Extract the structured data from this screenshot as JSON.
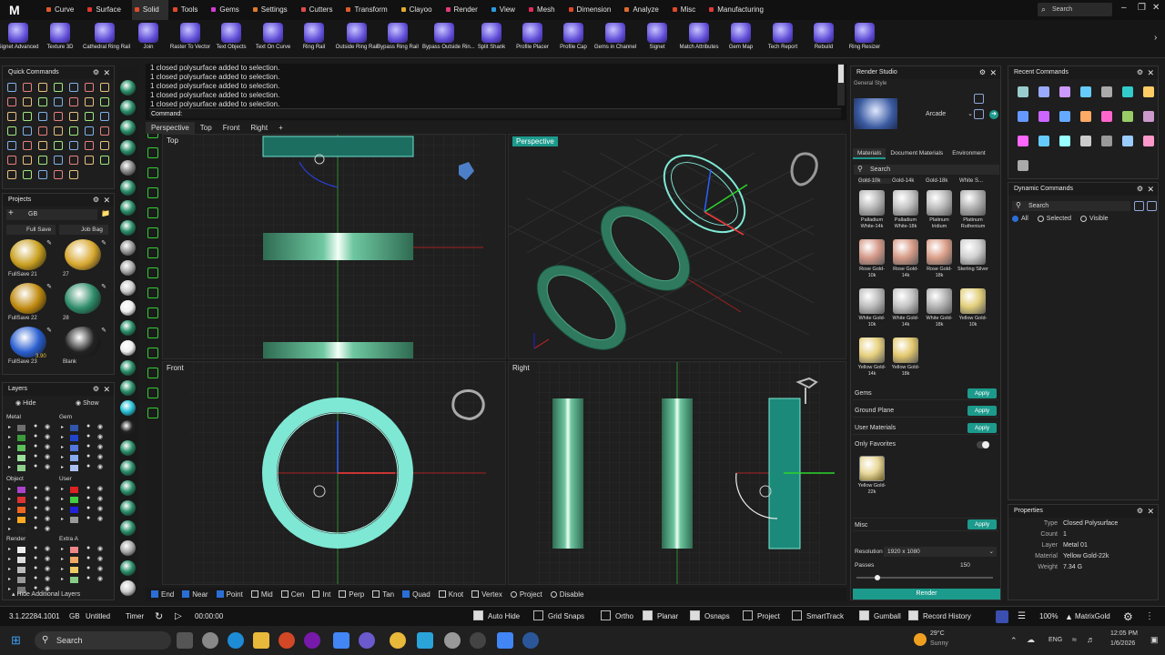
{
  "menubar": {
    "logo": "M",
    "search_placeholder": "Search",
    "items": [
      {
        "label": "Curve",
        "color": "#e05a2b"
      },
      {
        "label": "Surface",
        "color": "#e0362b"
      },
      {
        "label": "Solid",
        "color": "#e04b2b",
        "active": true
      },
      {
        "label": "Tools",
        "color": "#e0482b"
      },
      {
        "label": "Gems",
        "color": "#d43bd4"
      },
      {
        "label": "Settings",
        "color": "#e07a2b"
      },
      {
        "label": "Cutters",
        "color": "#e04b4b"
      },
      {
        "label": "Transform",
        "color": "#e05a2b"
      },
      {
        "label": "Clayoo",
        "color": "#e0aa2b"
      },
      {
        "label": "Render",
        "color": "#e03b7a"
      },
      {
        "label": "View",
        "color": "#2b9ae0"
      },
      {
        "label": "Mesh",
        "color": "#e02b5a"
      },
      {
        "label": "Dimension",
        "color": "#e0482b"
      },
      {
        "label": "Analyze",
        "color": "#e06a2b"
      },
      {
        "label": "Misc",
        "color": "#e0482b"
      },
      {
        "label": "Manufacturing",
        "color": "#e03b3b"
      }
    ]
  },
  "toolbar": {
    "tools": [
      "Signet Advanced",
      "Texture 3D",
      "Cathedral Ring Rail",
      "Join",
      "Raster To Vector",
      "Text Objects",
      "Text On Curve",
      "Ring Rail",
      "Outside Ring Rail",
      "Bypass Ring Rail",
      "Bypass Outside Rin...",
      "Split Shank",
      "Profile Placer",
      "Profile Cap",
      "Gems in Channel",
      "Signet",
      "Match Attributes",
      "Gem Map",
      "Tech Report",
      "Rebuild",
      "Ring Resizer"
    ]
  },
  "quick_commands": {
    "title": "Quick Commands"
  },
  "projects": {
    "title": "Projects",
    "folder": "GB",
    "full_save": "Full Save",
    "job_bag": "Job Bag",
    "items": [
      {
        "label": "FullSave 21",
        "color": "#c9a020"
      },
      {
        "label": "27",
        "color": "#d8a830"
      },
      {
        "label": "FullSave 22",
        "color": "#c08a10"
      },
      {
        "label": "28",
        "color": "#2e8c6a"
      },
      {
        "label": "FullSave 23",
        "color": "#2a5fd0",
        "price": "3.90"
      },
      {
        "label": "Blank",
        "color": "#222"
      }
    ]
  },
  "layers": {
    "title": "Layers",
    "hide": "Hide",
    "show": "Show",
    "groups": [
      {
        "label": "Metal",
        "colors": [
          "#6f6f6f",
          "#3c9c3c",
          "#5cc05c",
          "#9be09b",
          "#8cd08c"
        ]
      },
      {
        "label": "Gem",
        "colors": [
          "#3355aa",
          "#2244cc",
          "#5577dd",
          "#88aaee",
          "#aac0f0"
        ]
      },
      {
        "label": "Object",
        "colors": [
          "#aa44cc",
          "#dd3333",
          "#ee6622",
          "#ffaa22",
          "#222"
        ]
      },
      {
        "label": "User",
        "colors": [
          "#dd2222",
          "#44cc44",
          "#2222dd",
          "#999"
        ]
      },
      {
        "label": "Render",
        "colors": [
          "#eee",
          "#ddd",
          "#bbb",
          "#999",
          "#777"
        ]
      },
      {
        "label": "Extra A",
        "colors": [
          "#ee8888",
          "#eeaa66",
          "#eecc66",
          "#88cc88"
        ]
      }
    ],
    "hide_additional": "Hide Additional Layers"
  },
  "command": {
    "history": [
      "1 closed polysurface added to selection.",
      "1 closed polysurface added to selection.",
      "1 closed polysurface added to selection.",
      "1 closed polysurface added to selection.",
      "1 closed polysurface added to selection."
    ],
    "prompt": "Command:"
  },
  "viewport_tabs": [
    "Perspective",
    "Top",
    "Front",
    "Right",
    "+"
  ],
  "viewports": {
    "top": "Top",
    "perspective": "Perspective",
    "front": "Front",
    "right": "Right"
  },
  "osnaps": [
    {
      "label": "End",
      "on": true
    },
    {
      "label": "Near",
      "on": true
    },
    {
      "label": "Point",
      "on": true
    },
    {
      "label": "Mid",
      "on": false
    },
    {
      "label": "Cen",
      "on": false
    },
    {
      "label": "Int",
      "on": false
    },
    {
      "label": "Perp",
      "on": false
    },
    {
      "label": "Tan",
      "on": false
    },
    {
      "label": "Quad",
      "on": true
    },
    {
      "label": "Knot",
      "on": false
    },
    {
      "label": "Vertex",
      "on": false
    },
    {
      "label": "Project",
      "radio": true
    },
    {
      "label": "Disable",
      "radio": true
    }
  ],
  "render_studio": {
    "title": "Render Studio",
    "general_style": "General Style",
    "style_name": "Arcade",
    "tabs": [
      "Materials",
      "Document Materials",
      "Environment"
    ],
    "search_placeholder": "Search",
    "columns": [
      "Gold-10k",
      "Gold-14k",
      "Gold-18k",
      "White S..."
    ],
    "materials": [
      {
        "label": "Palladium White-14k",
        "color": "#b8b8b8"
      },
      {
        "label": "Palladium White-18k",
        "color": "#c2c2c2"
      },
      {
        "label": "Platinum Iridium",
        "color": "#bcbcbc"
      },
      {
        "label": "Platinum Ruthenium",
        "color": "#b0b0b0"
      },
      {
        "label": "Rose Gold-10k",
        "color": "#d59a8a"
      },
      {
        "label": "Rose Gold-14k",
        "color": "#d89c88"
      },
      {
        "label": "Rose Gold-18k",
        "color": "#dda08a"
      },
      {
        "label": "Sterling Silver",
        "color": "#d0d0d0"
      },
      {
        "label": "White Gold-10k",
        "color": "#bdbdbd"
      },
      {
        "label": "White Gold-14k",
        "color": "#c4c4c4"
      },
      {
        "label": "White Gold-18k",
        "color": "#b4b4b4"
      },
      {
        "label": "Yellow Gold-10k",
        "color": "#e2cf7a"
      },
      {
        "label": "Yellow Gold-14k",
        "color": "#e6d07e"
      },
      {
        "label": "Yellow Gold-18k",
        "color": "#e4c86e"
      }
    ],
    "sections": [
      {
        "label": "Gems",
        "apply": "Apply"
      },
      {
        "label": "Ground Plane",
        "apply": "Apply"
      },
      {
        "label": "User Materials",
        "apply": "Apply"
      }
    ],
    "only_favorites": "Only Favorites",
    "favorite": {
      "label": "Yellow Gold-22k",
      "color": "#e8d79a"
    },
    "misc": "Misc",
    "misc_apply": "Apply",
    "resolution_label": "Resolution",
    "resolution": "1920 x 1080",
    "passes_label": "Passes",
    "passes": "150",
    "render_button": "Render"
  },
  "recent_commands": {
    "title": "Recent Commands"
  },
  "dynamic_commands": {
    "title": "Dynamic Commands",
    "search_placeholder": "Search",
    "filters": [
      "All",
      "Selected",
      "Visible"
    ]
  },
  "properties": {
    "title": "Properties",
    "rows": [
      {
        "k": "Type",
        "v": "Closed Polysurface"
      },
      {
        "k": "Count",
        "v": "1"
      },
      {
        "k": "Layer",
        "v": "Metal 01"
      },
      {
        "k": "Material",
        "v": "Yellow Gold-22k"
      },
      {
        "k": "Weight",
        "v": "7.34 G"
      }
    ]
  },
  "status": {
    "version": "3.1.22284.1001",
    "units": "GB",
    "file": "Untitled",
    "timer": "Timer",
    "time": "00:00:00",
    "toggles": [
      {
        "label": "Auto Hide",
        "on": true
      },
      {
        "label": "Grid Snaps",
        "on": false
      },
      {
        "label": "Ortho",
        "on": false
      },
      {
        "label": "Planar",
        "on": true
      },
      {
        "label": "Osnaps",
        "on": true
      },
      {
        "label": "Project",
        "on": false
      },
      {
        "label": "SmartTrack",
        "on": false
      },
      {
        "label": "Gumball",
        "on": true
      },
      {
        "label": "Record History",
        "on": true
      }
    ],
    "zoom": "100%",
    "brand": "MatrixGold"
  },
  "taskbar": {
    "search": "Search",
    "weather_temp": "29°C",
    "weather_desc": "Sunny",
    "lang": "ENG",
    "time": "12:05 PM",
    "date": "1/6/2026"
  }
}
